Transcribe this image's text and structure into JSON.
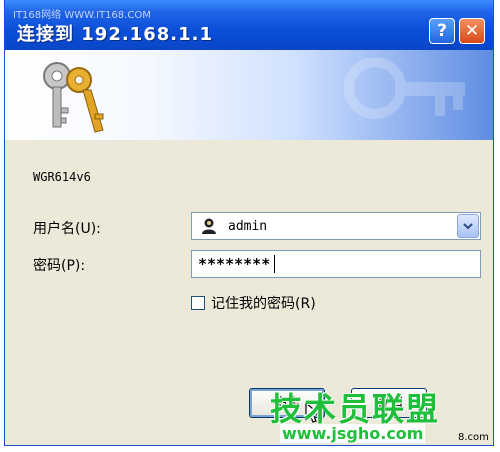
{
  "watermark_top": "IT168网络 WWW.IT168.COM",
  "window": {
    "title": "连接到 192.168.1.1",
    "help_label": "?",
    "close_label": "✕"
  },
  "server_name": "WGR614v6",
  "form": {
    "username_label": "用户名(U):",
    "username_value": "admin",
    "password_label": "密码(P):",
    "password_value": "********",
    "remember_label": "记住我的密码(R)",
    "remember_checked": false
  },
  "buttons": {
    "ok": "确定",
    "cancel": "取消"
  },
  "watermark_bottom": {
    "brand": "技术员联盟",
    "url": "www.jsgho.com",
    "side": "8.com"
  },
  "colors": {
    "titlebar": "#0b4fd8",
    "dialog_bg": "#ece9d8",
    "watermark": "#1fbf3a"
  }
}
